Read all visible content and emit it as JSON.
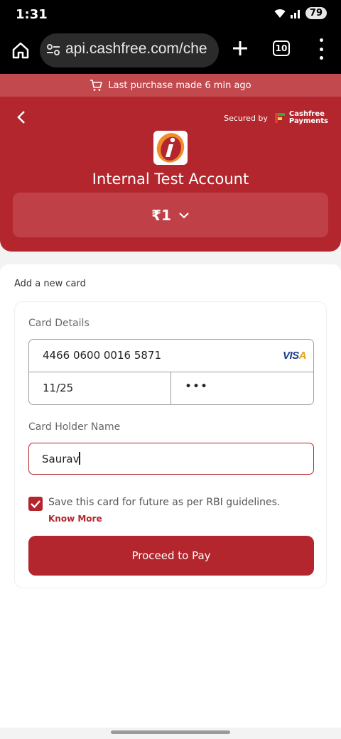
{
  "status_bar": {
    "time": "1:31",
    "battery": "79"
  },
  "browser": {
    "url": "api.cashfree.com/che",
    "tabs_count": "10"
  },
  "banner": {
    "text": "Last purchase made 6 min ago"
  },
  "header": {
    "secured_by": "Secured by",
    "provider_line1": "Cashfree",
    "provider_line2": "Payments",
    "merchant_name": "Internal Test Account",
    "amount": "₹1"
  },
  "card_section": {
    "title": "Add a new card",
    "card_details_label": "Card Details",
    "card_number": "4466 0600 0016 5871",
    "card_brand": "VISA",
    "expiry": "11/25",
    "cvv_masked": "•••",
    "holder_label": "Card Holder Name",
    "holder_name": "Saurav",
    "save_text": "Save this card for future as per RBI guidelines.",
    "save_checked": true,
    "know_more": "Know More",
    "pay_button": "Proceed to Pay"
  },
  "colors": {
    "brand": "#b3262d",
    "banner": "#c24a4f",
    "amount_box": "#c04047"
  }
}
